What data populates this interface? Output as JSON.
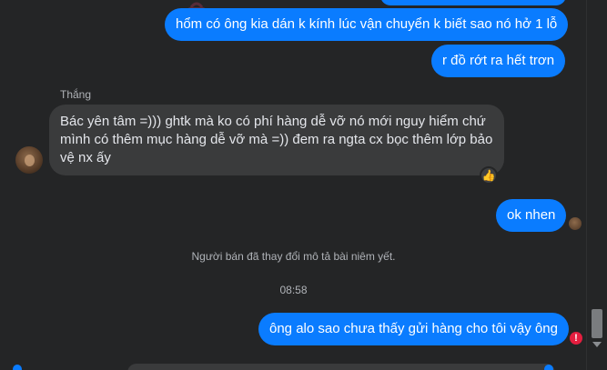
{
  "messages": {
    "m1": "hổm có ông kia dán k kính lúc vận chuyển k biết sao nó hở 1 lỗ",
    "m2": "r đồ rớt ra hết trơn",
    "sender_name": "Thắng",
    "m3": "Bác yên tâm =))) ghtk mà ko có phí hàng dễ vỡ nó mới nguy hiểm chứ mình có thêm mục hàng dễ vỡ mà =)) đem ra ngta cx bọc thêm lớp bảo vệ nx ấy",
    "m3_reaction": "👍",
    "m4": "ok nhen",
    "system_note": "Người bán đã thay đổi mô tả bài niêm yết.",
    "timestamp": "08:58",
    "m5": "ông alo sao chưa thấy gửi hàng cho tôi vậy ông"
  },
  "status": {
    "error_glyph": "!"
  },
  "colors": {
    "background": "#242526",
    "outgoing_bubble": "#0a7cff",
    "incoming_bubble": "#3a3b3c",
    "error": "#e41e3f"
  },
  "icons": {
    "reaction": "thumbs-up-icon",
    "error": "error-icon"
  }
}
